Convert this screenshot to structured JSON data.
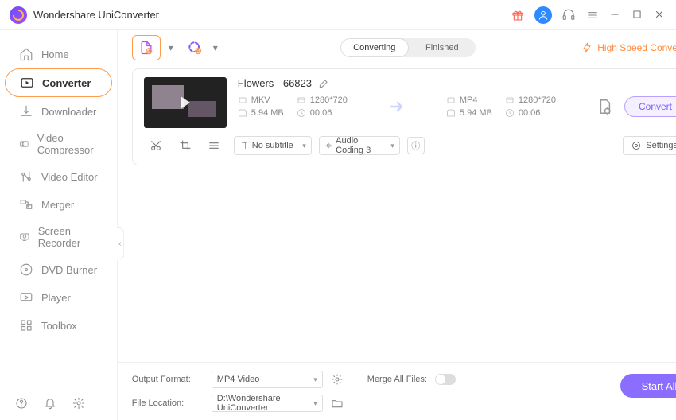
{
  "app_title": "Wondershare UniConverter",
  "sidebar": {
    "items": [
      {
        "label": "Home"
      },
      {
        "label": "Converter"
      },
      {
        "label": "Downloader"
      },
      {
        "label": "Video Compressor"
      },
      {
        "label": "Video Editor"
      },
      {
        "label": "Merger"
      },
      {
        "label": "Screen Recorder"
      },
      {
        "label": "DVD Burner"
      },
      {
        "label": "Player"
      },
      {
        "label": "Toolbox"
      }
    ],
    "active_index": 1
  },
  "tabs": {
    "converting": "Converting",
    "finished": "Finished",
    "active": "converting"
  },
  "high_speed_label": "High Speed Conversion",
  "file": {
    "name": "Flowers - 66823",
    "source": {
      "format": "MKV",
      "resolution": "1280*720",
      "size": "5.94 MB",
      "duration": "00:06"
    },
    "target": {
      "format": "MP4",
      "resolution": "1280*720",
      "size": "5.94 MB",
      "duration": "00:06"
    },
    "subtitle_label": "No subtitle",
    "audio_label": "Audio Coding 3",
    "settings_label": "Settings",
    "convert_label": "Convert"
  },
  "footer": {
    "output_format_label": "Output Format:",
    "output_format_value": "MP4 Video",
    "file_location_label": "File Location:",
    "file_location_value": "D:\\Wondershare UniConverter",
    "merge_label": "Merge All Files:",
    "start_label": "Start All"
  }
}
